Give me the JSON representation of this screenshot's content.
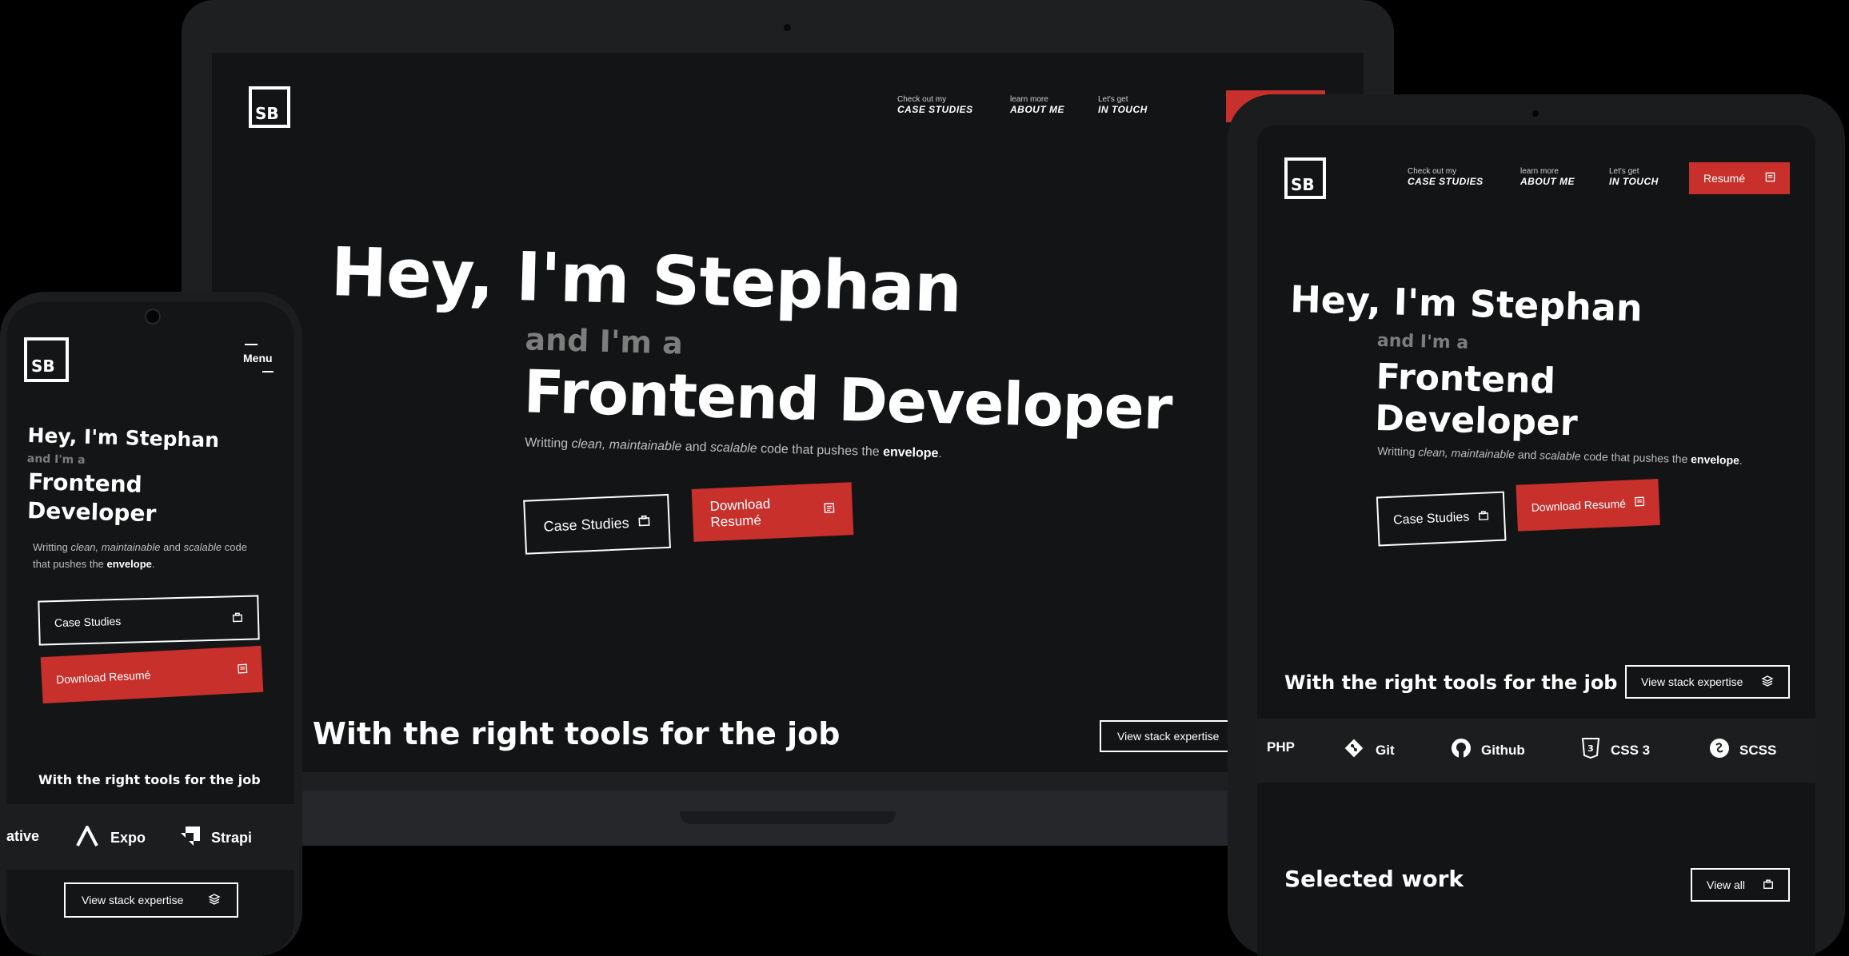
{
  "brand": {
    "logo_text": "SB"
  },
  "nav": {
    "case_studies": {
      "small": "Check out my",
      "big": "CASE STUDIES"
    },
    "about": {
      "small": "learn more",
      "big": "ABOUT ME"
    },
    "contact": {
      "small": "Let's get",
      "big": "IN TOUCH"
    },
    "resume_label": "Resumé",
    "menu_label": "Menu"
  },
  "hero": {
    "greeting": "Hey, I'm Stephan",
    "intro": "and I'm a",
    "role": "Frontend Developer",
    "role_line1": "Frontend",
    "role_line2": "Developer",
    "tag_prefix": "Writting",
    "tag_clean": "clean, maintainable",
    "tag_and": "and",
    "tag_scalable": "scalable",
    "tag_code": "code that pushes the",
    "tag_code_line1": "code",
    "tag_code_line2": "that pushes the",
    "tag_envelope": "envelope",
    "tag_end": ".",
    "case_studies_button": "Case Studies",
    "download_button": "Download Resumé"
  },
  "tools": {
    "heading": "With the right tools for the job",
    "stack_button": "View stack expertise",
    "tablet_items": [
      {
        "label": "PHP",
        "icon": "php-icon"
      },
      {
        "label": "Git",
        "icon": "git-icon"
      },
      {
        "label": "Github",
        "icon": "github-icon"
      },
      {
        "label": "CSS 3",
        "icon": "css3-icon"
      },
      {
        "label": "SCSS",
        "icon": "scss-icon"
      }
    ],
    "phone_items": [
      {
        "label": "ative",
        "icon": ""
      },
      {
        "label": "Expo",
        "icon": "expo-icon"
      },
      {
        "label": "Strapi",
        "icon": "strapi-icon"
      }
    ]
  },
  "work": {
    "heading": "Selected work",
    "view_all": "View all"
  },
  "colors": {
    "accent": "#c8302c",
    "background": "#131416",
    "strip": "#1c1d1f"
  }
}
